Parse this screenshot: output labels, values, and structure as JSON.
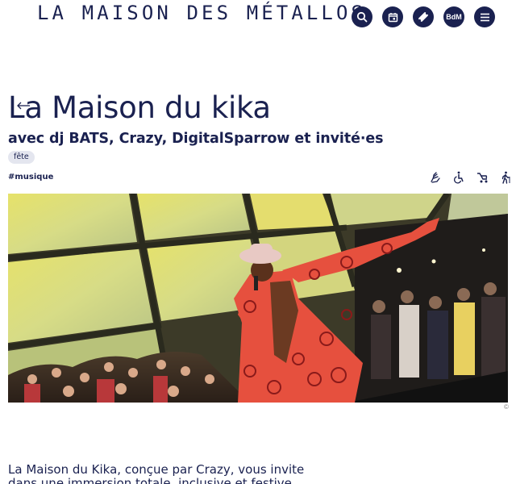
{
  "header": {
    "brand": "LA MAISON DES MÉTALLOS",
    "icons": [
      "search-icon",
      "calendar-icon",
      "ticket-icon",
      "bdm-icon",
      "menu-icon"
    ],
    "bdm_label": "BdM"
  },
  "event": {
    "title": "La Maison du kika",
    "subtitle": "avec dj BATS, Crazy, DigitalSparrow et invité·es",
    "tag": "fête",
    "hashtag": "#musique",
    "accessibility_icons": [
      "sign-language-icon",
      "wheelchair-icon",
      "stroller-icon",
      "walking-icon"
    ],
    "photo_credit": "©",
    "intro": "La Maison du Kika, conçue par Crazy, vous invite dans une immersion totale, inclusive et festive"
  },
  "colors": {
    "primary": "#1a2150",
    "tag_bg": "#e4e6ef",
    "background": "#ffffff"
  }
}
